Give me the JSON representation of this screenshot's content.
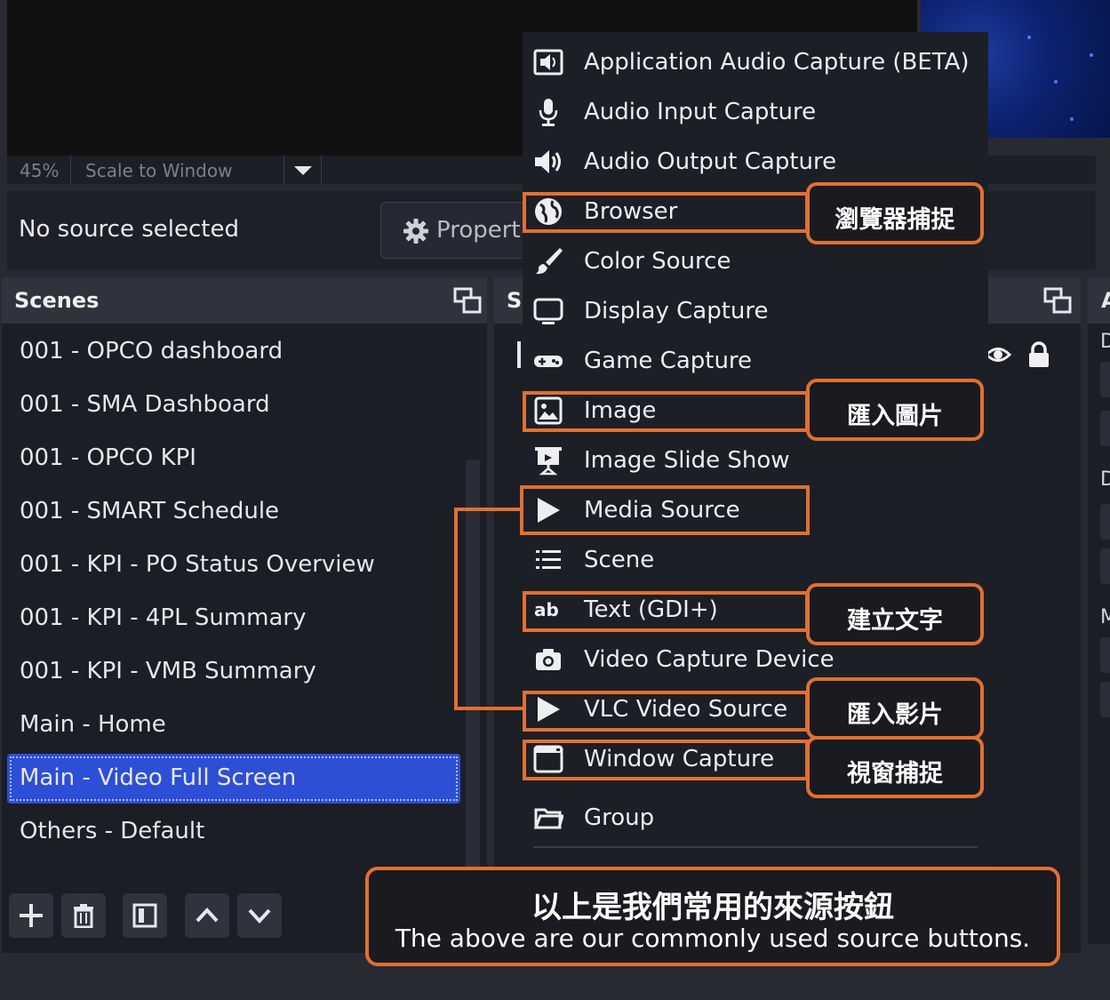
{
  "preview": {
    "zoom": "45%",
    "scale_mode": "Scale to Window"
  },
  "source_bar": {
    "status": "No source selected",
    "properties_label": "Properti"
  },
  "scenes": {
    "title": "Scenes",
    "items": [
      "001 - OPCO dashboard",
      "001 - SMA Dashboard",
      "001 - OPCO KPI",
      "001 - SMART Schedule",
      "001 - KPI - PO Status Overview",
      "001 - KPI - 4PL Summary",
      "001 - KPI - VMB Summary",
      "Main - Home",
      "Main - Video Full Screen",
      "Others - Default"
    ],
    "selected": "Main - Video Full Screen"
  },
  "sources": {
    "title": "S"
  },
  "right_panel": {
    "title": "A",
    "labels": [
      "D",
      "D",
      "M"
    ]
  },
  "menu": {
    "items": [
      {
        "label": "Application Audio Capture (BETA)",
        "icon": "app-audio-icon"
      },
      {
        "label": "Audio Input Capture",
        "icon": "microphone-icon"
      },
      {
        "label": "Audio Output Capture",
        "icon": "speaker-icon"
      },
      {
        "label": "Browser",
        "icon": "globe-icon"
      },
      {
        "label": "Color Source",
        "icon": "paintbrush-icon"
      },
      {
        "label": "Display Capture",
        "icon": "monitor-icon"
      },
      {
        "label": "Game Capture",
        "icon": "gamepad-icon"
      },
      {
        "label": "Image",
        "icon": "image-icon"
      },
      {
        "label": "Image Slide Show",
        "icon": "slideshow-icon"
      },
      {
        "label": "Media Source",
        "icon": "play-icon"
      },
      {
        "label": "Scene",
        "icon": "list-icon"
      },
      {
        "label": "Text (GDI+)",
        "icon": "text-ab-icon"
      },
      {
        "label": "Video Capture Device",
        "icon": "camera-icon"
      },
      {
        "label": "VLC Video Source",
        "icon": "play-icon"
      },
      {
        "label": "Window Capture",
        "icon": "window-icon"
      },
      {
        "label": "Group",
        "icon": "folder-icon"
      }
    ]
  },
  "annotations": {
    "browser": "瀏覽器捕捉",
    "image": "匯入圖片",
    "text": "建立文字",
    "video": "匯入影片",
    "window": "視窗捕捉",
    "caption_zh": "以上是我們常用的來源按鈕",
    "caption_en": "The above are our commonly used source buttons."
  },
  "colors": {
    "accent": "#e07032",
    "selection": "#2d4fd6",
    "background": "#272a33",
    "panel": "#1c1e25"
  }
}
